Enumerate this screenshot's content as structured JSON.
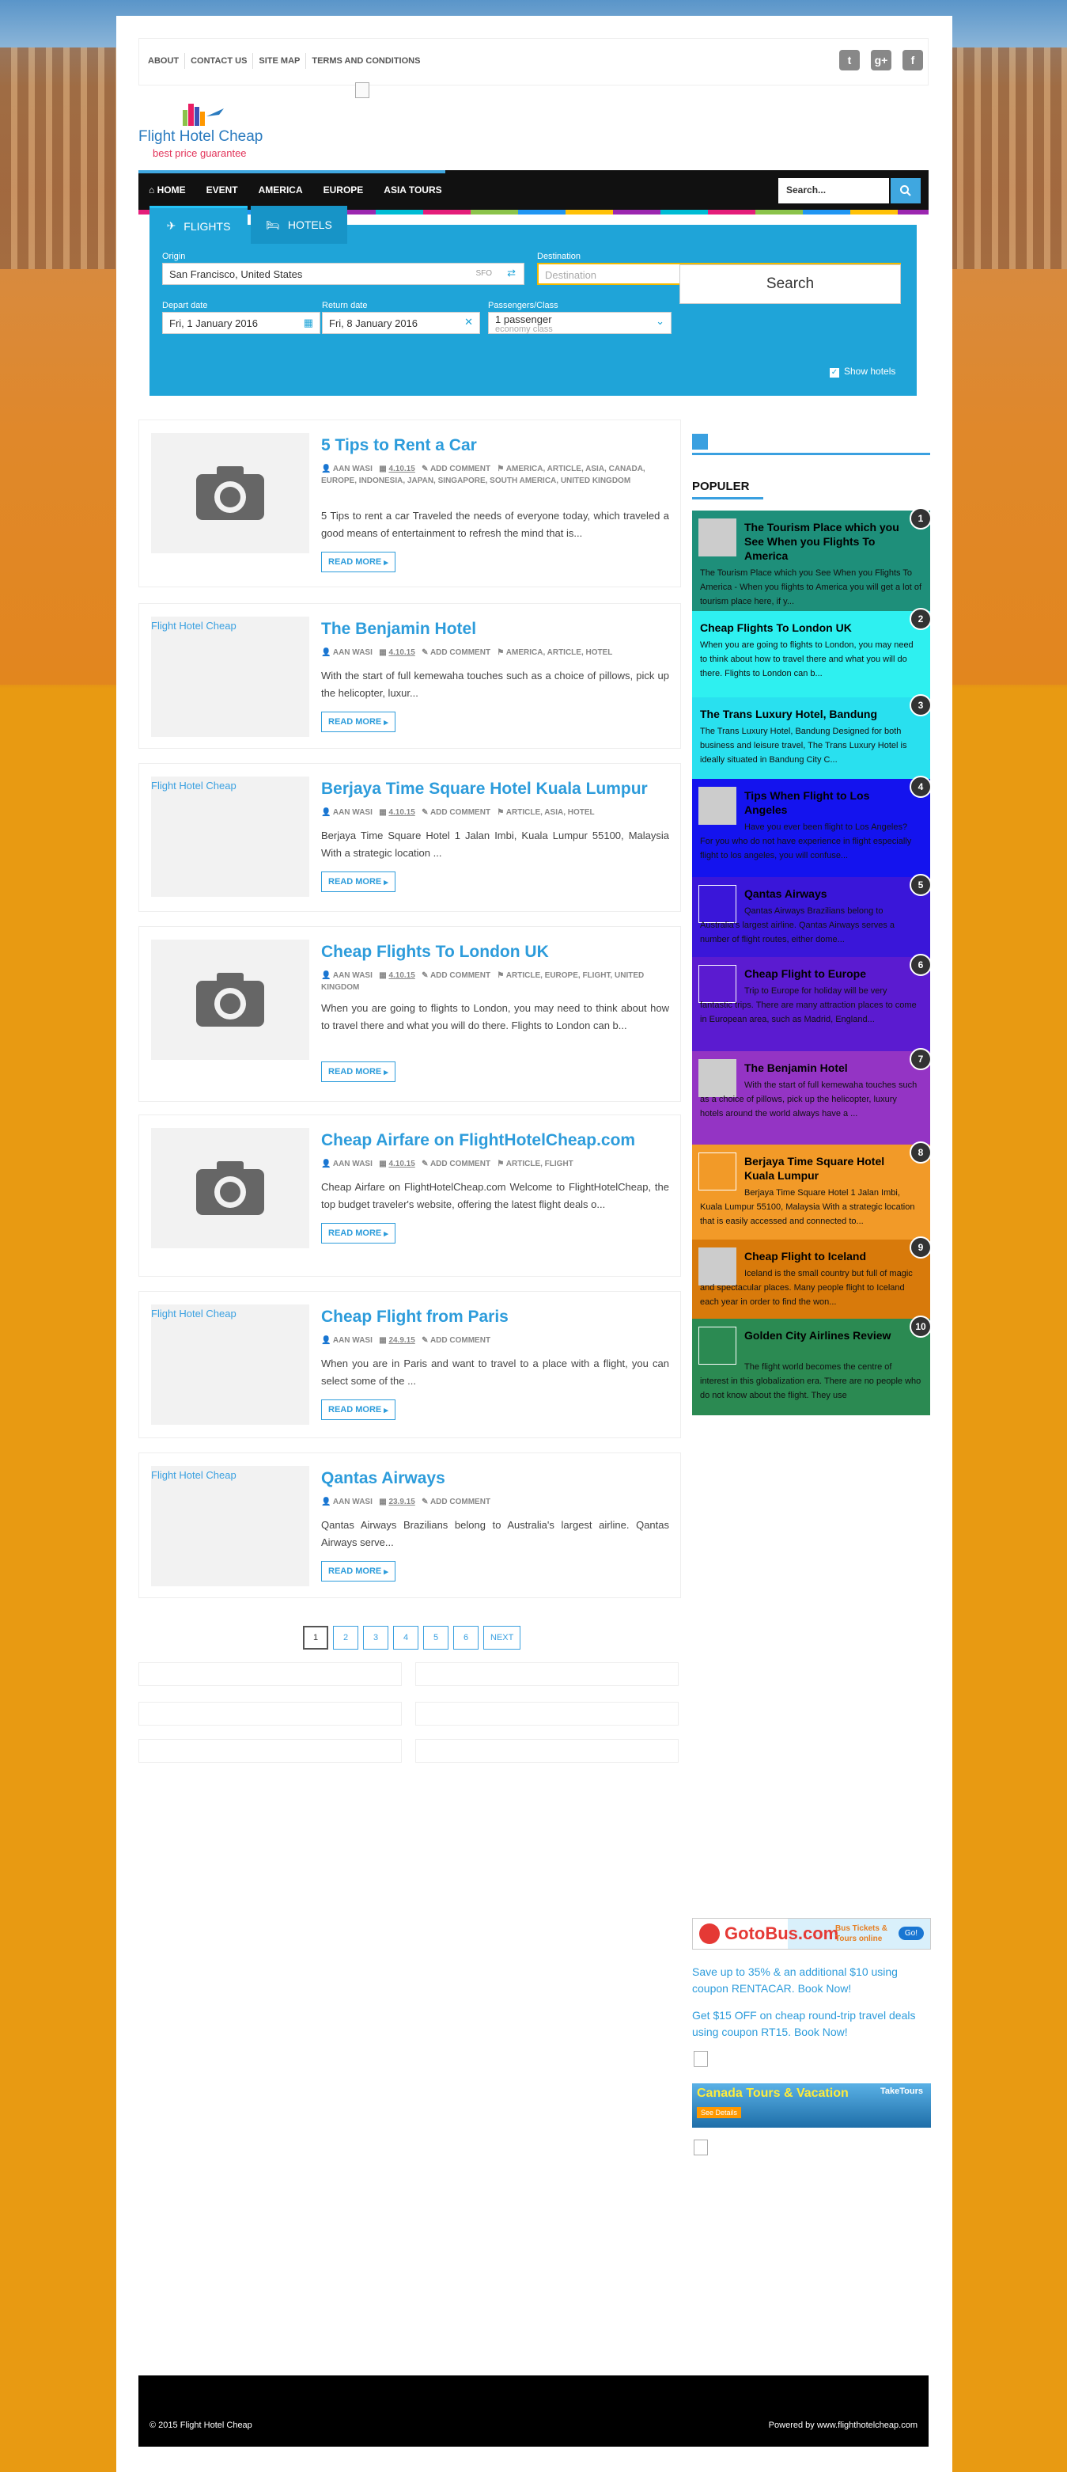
{
  "topnav": [
    "ABOUT",
    "CONTACT US",
    "SITE MAP",
    "TERMS AND CONDITIONS"
  ],
  "socials": [
    "twitter-icon",
    "google-plus-icon",
    "facebook-icon"
  ],
  "logo": {
    "name": "Flight Hotel Cheap",
    "tagline": "best price guarantee"
  },
  "mainnav": [
    "HOME",
    "EVENT",
    "AMERICA",
    "EUROPE",
    "ASIA TOURS"
  ],
  "search": {
    "placeholder": "Search..."
  },
  "widget": {
    "tab_flights": "FLIGHTS",
    "tab_hotels": "HOTELS",
    "origin_label": "Origin",
    "origin_value": "San Francisco, United States",
    "origin_code": "SFO",
    "dest_label": "Destination",
    "dest_placeholder": "Destination",
    "depart_label": "Depart date",
    "depart_value": "Fri, 1 January 2016",
    "return_label": "Return date",
    "return_value": "Fri, 8 January 2016",
    "pass_label": "Passengers/Class",
    "pass_value": "1 passenger",
    "pass_class": "economy class",
    "search_button": "Search",
    "show_hotels": "Show hotels"
  },
  "posts": [
    {
      "title": "5 Tips to Rent a Car",
      "author": "AAN WASI",
      "date": "4.10.15",
      "comment": "ADD COMMENT",
      "tags": "AMERICA, ARTICLE, ASIA, CANADA, EUROPE, INDONESIA, JAPAN, SINGAPORE, SOUTH AMERICA, UNITED KINGDOM",
      "excerpt": "5 Tips to rent a car   Traveled the needs of everyone today, which traveled a good means of entertainment to refresh the mind that is...",
      "thumb": "camera",
      "more": "READ MORE"
    },
    {
      "title": "The Benjamin Hotel",
      "author": "AAN WASI",
      "date": "4.10.15",
      "comment": "ADD COMMENT",
      "tags": "AMERICA, ARTICLE, HOTEL",
      "excerpt": "With the start of full kemewaha touches such as a choice of pillows, pick up the helicopter, luxur...",
      "thumb": "Flight Hotel Cheap",
      "more": "READ MORE"
    },
    {
      "title": "Berjaya Time Square Hotel Kuala Lumpur",
      "author": "AAN WASI",
      "date": "4.10.15",
      "comment": "ADD COMMENT",
      "tags": "ARTICLE, ASIA, HOTEL",
      "excerpt": "Berjaya Time Square Hotel 1 Jalan Imbi, Kuala Lumpur 55100, Malaysia   With a strategic location ...",
      "thumb": "Flight Hotel Cheap",
      "more": "READ MORE"
    },
    {
      "title": "Cheap Flights To London UK",
      "author": "AAN WASI",
      "date": "4.10.15",
      "comment": "ADD COMMENT",
      "tags": "ARTICLE, EUROPE, FLIGHT, UNITED KINGDOM",
      "excerpt": "When you are going to flights to London, you may need to think about how to travel there and what you will do there. Flights to London can b...",
      "thumb": "camera",
      "more": "READ MORE"
    },
    {
      "title": "Cheap Airfare on FlightHotelCheap.com",
      "author": "AAN WASI",
      "date": "4.10.15",
      "comment": "ADD COMMENT",
      "tags": "ARTICLE, FLIGHT",
      "excerpt": "Cheap Airfare on FlightHotelCheap.com Welcome to FlightHotelCheap, the top budget traveler's website, offering the latest flight deals o...",
      "thumb": "camera",
      "more": "READ MORE"
    },
    {
      "title": "Cheap Flight from Paris",
      "author": "AAN WASI",
      "date": "24.9.15",
      "comment": "ADD COMMENT",
      "tags": "",
      "excerpt": "When you are in Paris and want to travel to a place with a flight, you can select some of the ...",
      "thumb": "Flight Hotel Cheap",
      "more": "READ MORE"
    },
    {
      "title": "Qantas Airways",
      "author": "AAN WASI",
      "date": "23.9.15",
      "comment": "ADD COMMENT",
      "tags": "",
      "excerpt": "Qantas Airways Brazilians belong to Australia's largest airline. Qantas Airways serve...",
      "thumb": "Flight Hotel Cheap",
      "more": "READ MORE"
    }
  ],
  "pager": [
    "1",
    "2",
    "3",
    "4",
    "5",
    "6",
    "NEXT"
  ],
  "sidebar": {
    "heading": "POPULER",
    "items": [
      {
        "num": "1",
        "title": "The Tourism Place which you See When you Flights To America",
        "excerpt": "The Tourism Place which you See When you Flights To America - When you flights to America  you will get a lot of tourism place here, if y...",
        "color": "#1e8f7a"
      },
      {
        "num": "2",
        "title": "Cheap Flights To London UK",
        "excerpt": "When you are going to flights to London, you may need to think about how to travel there and what you will do there. Flights to London can b...",
        "color": "#2ef0f0"
      },
      {
        "num": "3",
        "title": "The Trans Luxury Hotel, Bandung",
        "excerpt": "The Trans Luxury Hotel, Bandung Designed for both business and leisure travel, The Trans Luxury Hotel is ideally situated in Bandung City C...",
        "color": "#29e0ef"
      },
      {
        "num": "4",
        "title": "Tips When Flight to Los Angeles",
        "excerpt": "Have you ever been flight to Los Angeles? For you who do not have experience in flight especially flight to los angeles, you will confuse...",
        "color": "#1413ee"
      },
      {
        "num": "5",
        "title": "Qantas Airways",
        "excerpt": "Qantas Airways Brazilians belong to Australia's largest airline. Qantas Airways serves a number of flight routes, either dome...",
        "color": "#3a16d9"
      },
      {
        "num": "6",
        "title": "Cheap Flight to Europe",
        "excerpt": "Trip to Europe for holiday will be very fantastic trips. There are many attraction places to come in European area, such as Madrid, England...",
        "color": "#5b1bd0"
      },
      {
        "num": "7",
        "title": "The Benjamin Hotel",
        "excerpt": "With the start of full kemewaha touches such as a choice of pillows, pick up the helicopter, luxury hotels around the world always have a ...",
        "color": "#9434c4"
      },
      {
        "num": "8",
        "title": "Berjaya Time Square Hotel Kuala Lumpur",
        "excerpt": "Berjaya Time Square Hotel 1 Jalan Imbi, Kuala Lumpur 55100, Malaysia   With a strategic location that is easily accessed and connected to...",
        "color": "#f29a28"
      },
      {
        "num": "9",
        "title": "Cheap Flight to Iceland",
        "excerpt": "Iceland is the small country but full of magic and spectacular places. Many people flight to Iceland each year in order to find the won...",
        "color": "#d87a0b"
      },
      {
        "num": "10",
        "title": "Golden City Airlines Review",
        "excerpt": "The flight world becomes the centre of interest in this globalization era. There are no people who do not know about the flight. They use",
        "color": "#2b8a52"
      }
    ]
  },
  "ads": {
    "gotobus_brand": "GotoBus.com",
    "gotobus_tagline": "Bus Tickets & Tours online",
    "gotobus_go": "Go!",
    "link1": "Save up to 35% & an additional $10 using coupon RENTACAR. Book Now!",
    "link2": "Get $15 OFF on cheap round-trip travel deals using coupon RT15. Book Now!",
    "canada": "Canada Tours & Vacation",
    "canada_brand": "TakeTours",
    "canada_btn": "See Details"
  },
  "footer": {
    "copyright": "© 2015 Flight Hotel Cheap",
    "powered": "Powered by www.flighthotelcheap.com"
  }
}
